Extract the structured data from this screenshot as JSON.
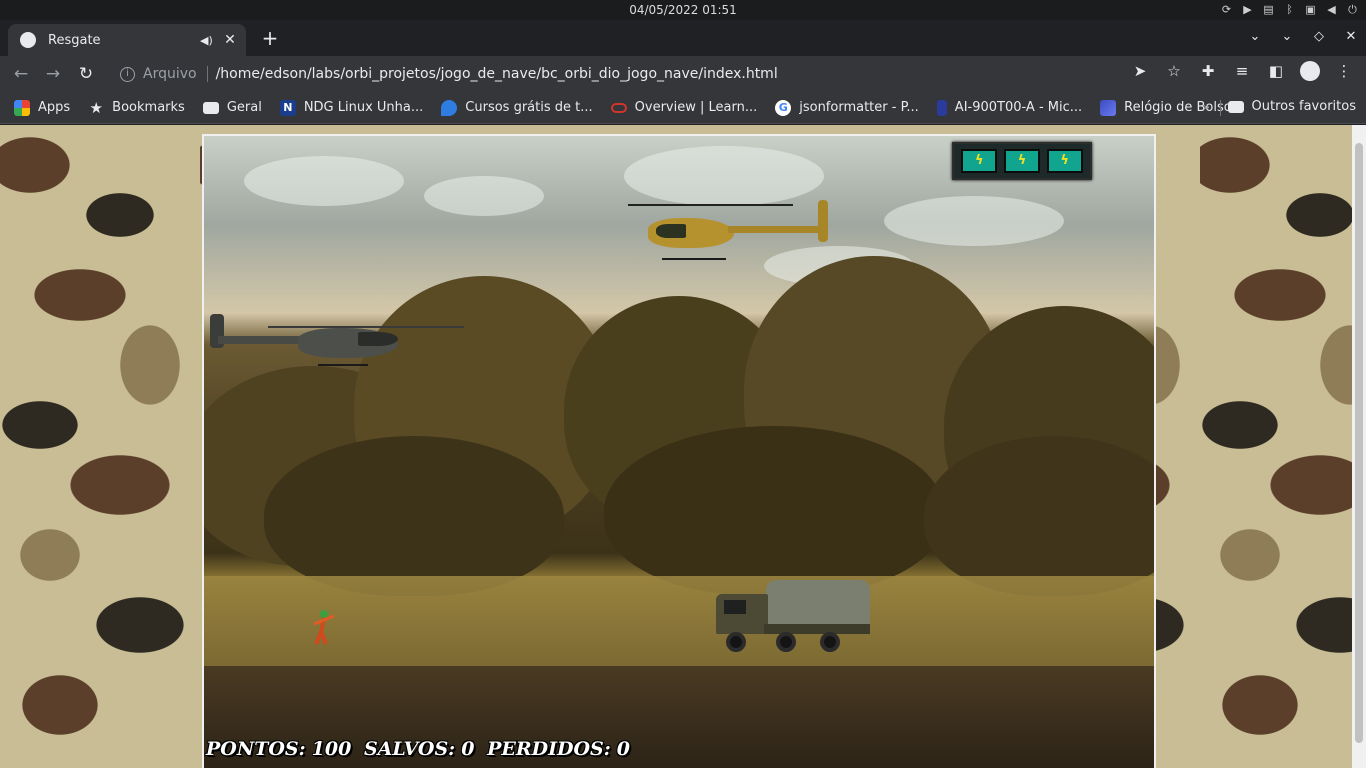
{
  "os": {
    "clock": "04/05/2022  01:51"
  },
  "browser": {
    "tab": {
      "title": "Resgate"
    },
    "omnibox": {
      "scheme_label": "Arquivo",
      "url": "/home/edson/labs/orbi_projetos/jogo_de_nave/bc_orbi_dio_jogo_nave/index.html"
    },
    "bookmarks": [
      {
        "label": "Apps",
        "icon": "apps-grid-icon",
        "color": "#ea4335"
      },
      {
        "label": "Bookmarks",
        "icon": "star-icon",
        "color": "#e8eaed"
      },
      {
        "label": "Geral",
        "icon": "folder-icon",
        "color": "#e8eaed"
      },
      {
        "label": "NDG Linux Unha...",
        "icon": "ndg-n-icon",
        "color": "#1a3d8f"
      },
      {
        "label": "Cursos grátis de t...",
        "icon": "drop-icon",
        "color": "#2f7de1"
      },
      {
        "label": "Overview | Learn...",
        "icon": "oracle-ring-icon",
        "color": "#d0352b"
      },
      {
        "label": "jsonformatter - P...",
        "icon": "google-g-icon",
        "color": "#ffffff"
      },
      {
        "label": "AI-900T00-A - Mic...",
        "icon": "doc-icon",
        "color": "#2a3b9c"
      },
      {
        "label": "Relógio de Bolso...",
        "icon": "wave-icon",
        "color": "#3b4cc0"
      }
    ],
    "other_bookmarks": "Outros favoritos"
  },
  "game": {
    "score_label": "PONTOS:",
    "score_value": "100",
    "saved_label": "SALVOS:",
    "saved_value": "0",
    "lost_label": "PERDIDOS:",
    "lost_value": "0",
    "energy_cells": 3,
    "energy_color": "#11a58f"
  }
}
